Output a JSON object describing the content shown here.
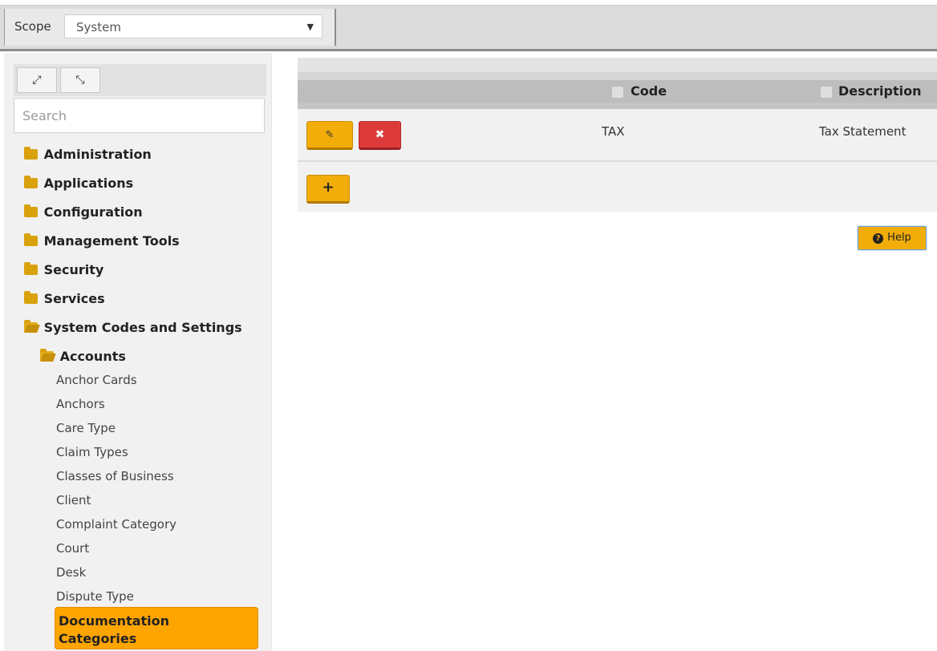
{
  "scope": {
    "label": "Scope",
    "selected": "System"
  },
  "tree": {
    "search_placeholder": "Search",
    "expand_all_icon": "expand-icon",
    "collapse_all_icon": "collapse-icon",
    "folders": [
      {
        "label": "Administration"
      },
      {
        "label": "Applications"
      },
      {
        "label": "Configuration"
      },
      {
        "label": "Management Tools"
      },
      {
        "label": "Security"
      },
      {
        "label": "Services"
      },
      {
        "label": "System Codes and Settings"
      }
    ],
    "subfolder": {
      "label": "Accounts"
    },
    "leaves": [
      "Anchor Cards",
      "Anchors",
      "Care Type",
      "Claim Types",
      "Classes of Business",
      "Client",
      "Complaint Category",
      "Court",
      "Desk",
      "Dispute Type"
    ],
    "selected": {
      "line1": "Documentation",
      "line2": "Categories"
    }
  },
  "grid": {
    "columns": {
      "code": "Code",
      "description": "Description"
    },
    "rows": [
      {
        "code": "TAX",
        "description": "Tax Statement"
      }
    ],
    "add_label": "+"
  },
  "help": {
    "label": "Help"
  },
  "colors": {
    "accent": "#f2ad0a",
    "selected": "#ffa500",
    "delete": "#dd3b3b"
  }
}
